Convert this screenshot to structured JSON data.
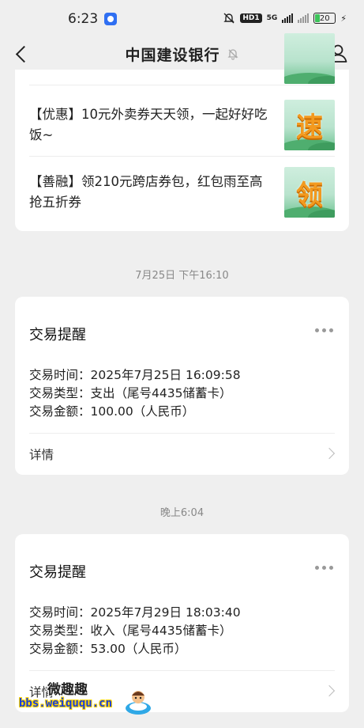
{
  "status_bar": {
    "time": "6:23",
    "network": "5G",
    "hd": "HD1",
    "battery": "20"
  },
  "nav": {
    "title": "中国建设银行"
  },
  "promos": [
    {
      "text": "【优惠】10元外卖券天天领，一起好好吃饭~",
      "thumb_glyph": "速"
    },
    {
      "text": "【善融】领210元跨店券包，红包雨至高抢五折券",
      "thumb_glyph": "领"
    }
  ],
  "timestamps": [
    "7月25日 下午16:10",
    "晚上6:04"
  ],
  "transactions": [
    {
      "title": "交易提醒",
      "lines": [
        "交易时间：2025年7月25日 16:09:58",
        "交易类型：支出（尾号4435储蓄卡）",
        "交易金额：100.00（人民币）"
      ],
      "detail": "详情"
    },
    {
      "title": "交易提醒",
      "lines": [
        "交易时间：2025年7月29日 18:03:40",
        "交易类型：收入（尾号4435储蓄卡）",
        "交易金额：53.00（人民币）"
      ],
      "detail": "详情"
    }
  ],
  "watermark": {
    "top": "微趣趣",
    "bottom": "bbs.weiququ.cn"
  },
  "icons": {
    "back": "chevron-left-icon",
    "mute": "bell-off-icon",
    "profile": "person-icon",
    "more": "more-horizontal-icon",
    "detail_arrow": "chevron-right-icon"
  },
  "colors": {
    "background": "#efefef",
    "card": "#ffffff",
    "thumb_glyph": "#f39a1f",
    "battery_fill": "#3cc45a"
  }
}
